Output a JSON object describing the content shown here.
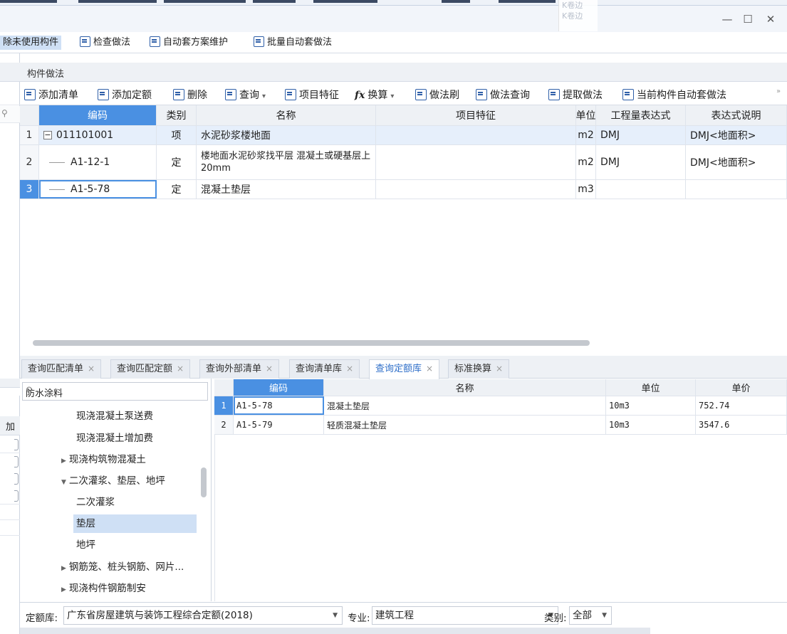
{
  "window": {
    "overlay_lines": [
      "K卷边",
      "K卷边"
    ]
  },
  "main_toolbar": {
    "items": [
      {
        "label": "除未使用构件"
      },
      {
        "label": "检查做法"
      },
      {
        "label": "自动套方案维护"
      },
      {
        "label": "批量自动套做法"
      }
    ]
  },
  "panel": {
    "title": "构件做法",
    "toolbar": [
      {
        "label": "添加清单"
      },
      {
        "label": "添加定额"
      },
      {
        "label": "删除"
      },
      {
        "label": "查询"
      },
      {
        "label": "项目特征"
      },
      {
        "label": "换算"
      },
      {
        "label": "做法刷"
      },
      {
        "label": "做法查询"
      },
      {
        "label": "提取做法"
      },
      {
        "label": "当前构件自动套做法"
      }
    ],
    "fx_label": "fx"
  },
  "method_table": {
    "headers": [
      "编码",
      "类别",
      "名称",
      "项目特征",
      "单位",
      "工程量表达式",
      "表达式说明"
    ],
    "rows": [
      {
        "num": "1",
        "code": "011101001",
        "type": "项",
        "name": "水泥砂浆楼地面",
        "feature": "",
        "unit": "m2",
        "expr": "DMJ",
        "desc": "DMJ<地面积>"
      },
      {
        "num": "2",
        "code": "A1-12-1",
        "type": "定",
        "name": "楼地面水泥砂浆找平层 混凝土或硬基层上 20mm",
        "feature": "",
        "unit": "m2",
        "expr": "DMJ",
        "desc": "DMJ<地面积>"
      },
      {
        "num": "3",
        "code": "A1-5-78",
        "type": "定",
        "name": "混凝土垫层",
        "feature": "",
        "unit": "m3",
        "expr": "",
        "desc": ""
      }
    ]
  },
  "tabs": [
    {
      "label": "查询匹配清单",
      "active": false
    },
    {
      "label": "查询匹配定额",
      "active": false
    },
    {
      "label": "查询外部清单",
      "active": false
    },
    {
      "label": "查询清单库",
      "active": false
    },
    {
      "label": "查询定额库",
      "active": true
    },
    {
      "label": "标准换算",
      "active": false
    }
  ],
  "search": {
    "value": "防水涂料"
  },
  "tree": [
    {
      "label": "现浇混凝土泵送费",
      "level": 2,
      "expandable": false,
      "selected": false
    },
    {
      "label": "现浇混凝土增加费",
      "level": 2,
      "expandable": false,
      "selected": false
    },
    {
      "label": "现浇构筑物混凝土",
      "level": 1,
      "expandable": true,
      "expanded": false,
      "selected": false
    },
    {
      "label": "二次灌浆、垫层、地坪",
      "level": 1,
      "expandable": true,
      "expanded": true,
      "selected": false
    },
    {
      "label": "二次灌浆",
      "level": 2,
      "expandable": false,
      "selected": false
    },
    {
      "label": "垫层",
      "level": 2,
      "expandable": false,
      "selected": true
    },
    {
      "label": "地坪",
      "level": 2,
      "expandable": false,
      "selected": false
    },
    {
      "label": "钢筋笼、桩头钢筋、网片...",
      "level": 1,
      "expandable": true,
      "expanded": false,
      "selected": false
    },
    {
      "label": "现浇构件钢筋制安",
      "level": 1,
      "expandable": true,
      "expanded": false,
      "selected": false
    }
  ],
  "quota_table": {
    "headers": [
      "编码",
      "名称",
      "单位",
      "单价"
    ],
    "rows": [
      {
        "num": "1",
        "code": "A1-5-78",
        "name": "混凝土垫层",
        "unit": "10m3",
        "price": "752.74"
      },
      {
        "num": "2",
        "code": "A1-5-79",
        "name": "轻质混凝土垫层",
        "unit": "10m3",
        "price": "3547.6"
      }
    ]
  },
  "footer": {
    "library_label": "定额库:",
    "library_value": "广东省房屋建筑与装饰工程综合定额(2018)",
    "specialty_label": "专业:",
    "specialty_value": "建筑工程",
    "category_label": "类别:",
    "category_value": "全部"
  },
  "left_strip": {
    "header_fragment": "加"
  },
  "colors": {
    "accent": "#4a90e2",
    "selection": "#cfe0f5",
    "active_tab_text": "#2f6fc9"
  }
}
